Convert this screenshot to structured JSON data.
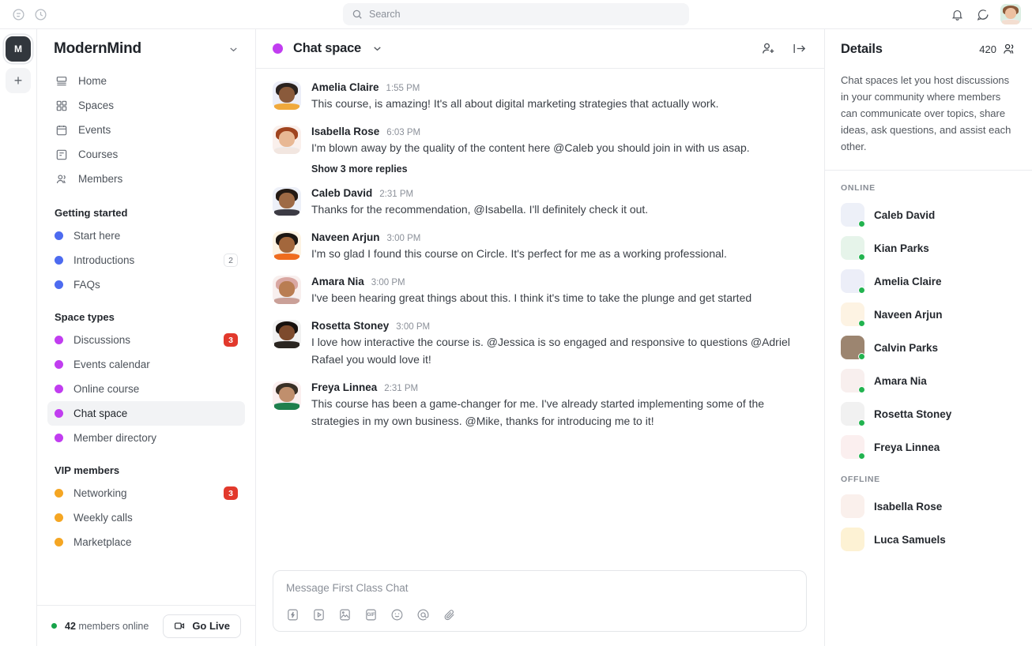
{
  "topbar": {
    "icons": [
      "compass-icon",
      "clock-icon"
    ],
    "search": {
      "placeholder": "Search",
      "value": ""
    },
    "right_icons": [
      "bell-icon",
      "chat-bubble-icon"
    ],
    "avatar_alt": "user-avatar"
  },
  "rail": {
    "workspace_initial": "M",
    "add_label": "+"
  },
  "sidebar": {
    "brand": "ModernMind",
    "nav": [
      {
        "label": "Home",
        "icon": "home-icon"
      },
      {
        "label": "Spaces",
        "icon": "grid-icon"
      },
      {
        "label": "Events",
        "icon": "calendar-icon"
      },
      {
        "label": "Courses",
        "icon": "course-icon"
      },
      {
        "label": "Members",
        "icon": "members-icon"
      }
    ],
    "sections": [
      {
        "title": "Getting started",
        "dot_color": "#4d6bf0",
        "items": [
          {
            "label": "Start here",
            "badge": "",
            "badge_type": "none",
            "active": false
          },
          {
            "label": "Introductions",
            "badge": "2",
            "badge_type": "plain",
            "active": false
          },
          {
            "label": "FAQs",
            "badge": "",
            "badge_type": "none",
            "active": false
          }
        ]
      },
      {
        "title": "Space types",
        "dot_color": "#c13df0",
        "items": [
          {
            "label": "Discussions",
            "badge": "3",
            "badge_type": "red",
            "active": false
          },
          {
            "label": "Events calendar",
            "badge": "",
            "badge_type": "none",
            "active": false
          },
          {
            "label": "Online course",
            "badge": "",
            "badge_type": "none",
            "active": false
          },
          {
            "label": "Chat space",
            "badge": "",
            "badge_type": "none",
            "active": true
          },
          {
            "label": "Member directory",
            "badge": "",
            "badge_type": "none",
            "active": false
          }
        ]
      },
      {
        "title": "VIP members",
        "dot_color": "#f5a623",
        "items": [
          {
            "label": "Networking",
            "badge": "3",
            "badge_type": "red",
            "active": false
          },
          {
            "label": "Weekly calls",
            "badge": "",
            "badge_type": "none",
            "active": false
          },
          {
            "label": "Marketplace",
            "badge": "",
            "badge_type": "none",
            "active": false
          }
        ]
      }
    ],
    "footer": {
      "online_count": "42",
      "online_suffix": " members online",
      "go_live_label": "Go Live",
      "go_live_icon": "video-camera-icon"
    }
  },
  "chat": {
    "header": {
      "title": "Chat space",
      "dot_color": "#c13df0",
      "caret_icon": "chevron-down-icon",
      "actions": [
        "add-member-icon",
        "collapse-panel-icon"
      ]
    },
    "messages": [
      {
        "name": "Amelia Claire",
        "time": "1:55 PM",
        "text": "This course, is amazing! It's all about digital marketing strategies that actually work.",
        "replies": "",
        "av_hair": "#2b2320",
        "av_skin": "#8a5a3b",
        "av_body": "#f0a93c",
        "av_bg": "#eceef8"
      },
      {
        "name": "Isabella Rose",
        "time": "6:03 PM",
        "text": "I'm blown away by the quality of the content here @Caleb you should join in with us asap.",
        "replies": "Show 3 more replies",
        "av_hair": "#a0441f",
        "av_skin": "#e8b894",
        "av_body": "#f2e6e0",
        "av_bg": "#faf0ec"
      },
      {
        "name": "Caleb David",
        "time": "2:31 PM",
        "text": "Thanks for the recommendation, @Isabella. I'll definitely check it out.",
        "replies": "",
        "av_hair": "#231a14",
        "av_skin": "#9e6a45",
        "av_body": "#3c3b44",
        "av_bg": "#edf0f8"
      },
      {
        "name": "Naveen Arjun",
        "time": "3:00 PM",
        "text": "I'm so glad I found this course on Circle. It's perfect for me as a working professional.",
        "replies": "",
        "av_hair": "#1d1713",
        "av_skin": "#a3673c",
        "av_body": "#ef6c1e",
        "av_bg": "#fdf3e3"
      },
      {
        "name": "Amara Nia",
        "time": "3:00 PM",
        "text": "I've been hearing great things about this. I think it's time to take the plunge and get started",
        "replies": "",
        "av_hair": "#d9a7a2",
        "av_skin": "#b97d52",
        "av_body": "#caa098",
        "av_bg": "#f8efee"
      },
      {
        "name": "Rosetta Stoney",
        "time": "3:00 PM",
        "text": "I love how interactive the course is. @Jessica is so engaged and responsive to questions @Adriel Rafael you would love it!",
        "replies": "",
        "av_hair": "#17110e",
        "av_skin": "#7d4a2c",
        "av_body": "#2a2520",
        "av_bg": "#f1f1f1"
      },
      {
        "name": "Freya Linnea",
        "time": "2:31 PM",
        "text": "This course has been a game-changer for me. I've already started implementing some of the strategies in my own business. @Mike, thanks for introducing me to it!",
        "replies": "",
        "av_hair": "#3a3026",
        "av_skin": "#c08f6d",
        "av_body": "#1f7f4d",
        "av_bg": "#fbefef"
      }
    ],
    "composer": {
      "placeholder": "Message First Class Chat",
      "tools": [
        "lightning-box-icon",
        "video-box-icon",
        "image-box-icon",
        "gif-box-icon",
        "emoji-icon",
        "mention-icon",
        "attachment-icon"
      ],
      "gif_label": "GIF"
    }
  },
  "details": {
    "title": "Details",
    "member_count": "420",
    "member_icon": "members-icon",
    "description": "Chat spaces let you host discussions in your community where members can communicate over topics, share ideas, ask questions, and assist each other.",
    "groups": [
      {
        "title": "ONLINE",
        "members": [
          {
            "name": "Caleb David",
            "online": true,
            "hair": "#231a14",
            "skin": "#9e6a45",
            "body": "#3c3b44",
            "bg": "#edf0f8"
          },
          {
            "name": "Kian Parks",
            "online": true,
            "hair": "#7a4a2a",
            "skin": "#e0b088",
            "body": "#2f6e4e",
            "bg": "#e6f4ea"
          },
          {
            "name": "Amelia Claire",
            "online": true,
            "hair": "#2b2320",
            "skin": "#8a5a3b",
            "body": "#f0a93c",
            "bg": "#eceef8"
          },
          {
            "name": "Naveen Arjun",
            "online": true,
            "hair": "#1d1713",
            "skin": "#a3673c",
            "body": "#ef6c1e",
            "bg": "#fdf3e3"
          },
          {
            "name": "Calvin Parks",
            "online": true,
            "hair": "#1a1411",
            "skin": "#6f4527",
            "body": "#2b2621",
            "bg": "#9c8570"
          },
          {
            "name": "Amara Nia",
            "online": true,
            "hair": "#d9a7a2",
            "skin": "#b97d52",
            "body": "#caa098",
            "bg": "#f8efee"
          },
          {
            "name": "Rosetta Stoney",
            "online": true,
            "hair": "#17110e",
            "skin": "#7d4a2c",
            "body": "#2a2520",
            "bg": "#f1f1f1"
          },
          {
            "name": "Freya Linnea",
            "online": true,
            "hair": "#3a3026",
            "skin": "#c08f6d",
            "body": "#1f7f4d",
            "bg": "#fbefef"
          }
        ]
      },
      {
        "title": "OFFLINE",
        "members": [
          {
            "name": "Isabella Rose",
            "online": false,
            "hair": "#a0441f",
            "skin": "#e8b894",
            "body": "#f2e6e0",
            "bg": "#faf0ec"
          },
          {
            "name": "Luca Samuels",
            "online": false,
            "hair": "#9a9a9a",
            "skin": "#5a4030",
            "body": "#2e2a26",
            "bg": "#fdf2d4"
          }
        ]
      }
    ]
  }
}
